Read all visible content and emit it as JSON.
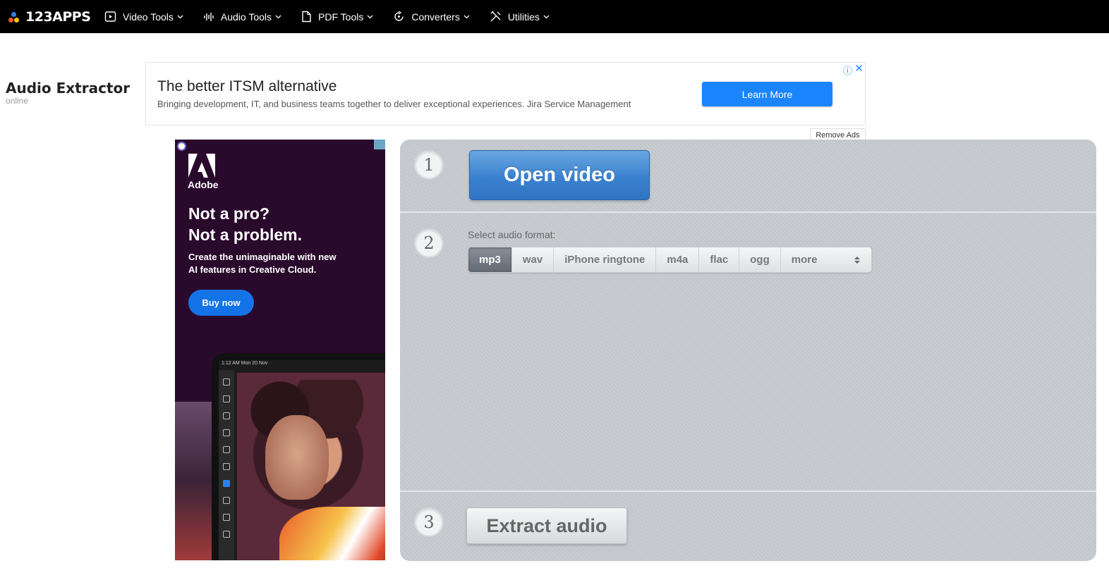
{
  "header": {
    "logo_text": "123APPS",
    "logo_colors": [
      "#ff5a1f",
      "#ffc400",
      "#2f80ed"
    ],
    "nav": [
      {
        "label": "Video Tools",
        "icon": "play-circle-icon"
      },
      {
        "label": "Audio Tools",
        "icon": "audio-wave-icon"
      },
      {
        "label": "PDF Tools",
        "icon": "document-icon"
      },
      {
        "label": "Converters",
        "icon": "convert-icon"
      },
      {
        "label": "Utilities",
        "icon": "tools-icon"
      }
    ]
  },
  "page": {
    "title": "Audio Extractor",
    "subtitle": "online"
  },
  "banner_ad": {
    "title": "The better ITSM alternative",
    "description": "Bringing development, IT, and business teams together to deliver exceptional experiences. Jira Service Management",
    "button": "Learn More",
    "remove_ads": "Remove Ads",
    "accent_color": "#1a85ff"
  },
  "side_ad": {
    "brand": "Adobe",
    "headline_1": "Not a pro?",
    "headline_2": "Not a problem.",
    "body_1": "Create the unimaginable with new",
    "body_2": "AI features in Creative Cloud.",
    "button": "Buy now",
    "device_status": "1:12 AM   Mon 20 Nov",
    "background_color": "#2a0a2c"
  },
  "tool": {
    "step1": {
      "number": "1",
      "button": "Open video"
    },
    "step2": {
      "number": "2",
      "label": "Select audio format:",
      "formats": [
        "mp3",
        "wav",
        "iPhone ringtone",
        "m4a",
        "flac",
        "ogg"
      ],
      "selected": "mp3",
      "more_label": "more"
    },
    "step3": {
      "number": "3",
      "button": "Extract audio"
    },
    "primary_color": "#3a82cf"
  }
}
